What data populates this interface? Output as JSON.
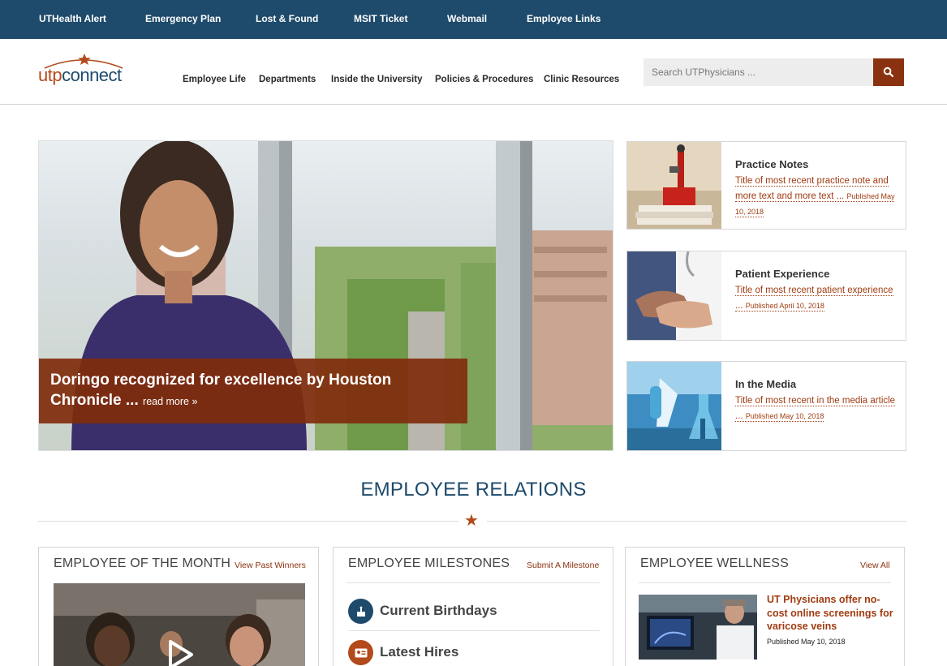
{
  "topbar": {
    "links": [
      "UTHealth Alert",
      "Emergency Plan",
      "Lost & Found",
      "MSIT Ticket",
      "Webmail",
      "Employee Links"
    ]
  },
  "logo": {
    "part1": "utp",
    "part2": "connect"
  },
  "nav": {
    "items": [
      "Employee Life",
      "Departments",
      "Inside the University",
      "Policies & Procedures",
      "Clinic Resources"
    ]
  },
  "search": {
    "placeholder": "Search UTPhysicians ..."
  },
  "hero": {
    "title": "Doringo recognized for excellence by Houston Chronicle ...",
    "read_more": "read more »"
  },
  "cards": [
    {
      "title": "Practice Notes",
      "link": "Title of most recent practice note and more text and more text ...",
      "date": "Published May 10, 2018"
    },
    {
      "title": "Patient Experience",
      "link": "Title of most recent patient experience ...",
      "date": "Published April 10, 2018"
    },
    {
      "title": "In the Media",
      "link": "Title of most recent in the media article ...",
      "date": "Published May 10, 2018"
    }
  ],
  "employee_relations": {
    "heading": "EMPLOYEE RELATIONS"
  },
  "panels": {
    "month": {
      "title": "EMPLOYEE OF THE MONTH",
      "link": "View Past Winners"
    },
    "milestones": {
      "title": "EMPLOYEE MILESTONES",
      "link": "Submit A Milestone",
      "items": [
        "Current Birthdays",
        "Latest Hires"
      ]
    },
    "wellness": {
      "title": "EMPLOYEE WELLNESS",
      "link": "View All",
      "article_title": "UT Physicians offer no-cost online screenings for varicose veins",
      "article_date": "Published May 10, 2018"
    }
  },
  "colors": {
    "brand_blue": "#1e4a6b",
    "brand_rust": "#8a3210",
    "accent_orange": "#b24a1b"
  }
}
